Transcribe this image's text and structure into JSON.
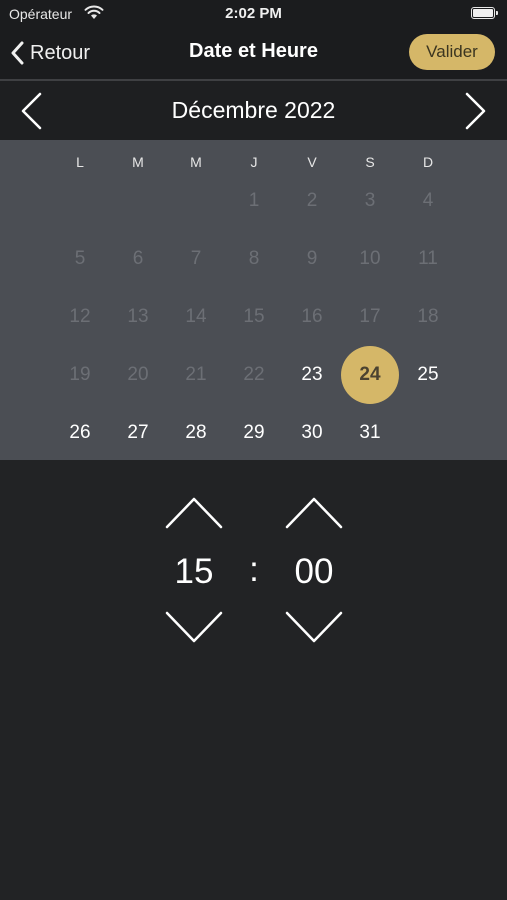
{
  "status_bar": {
    "carrier": "Opérateur",
    "time": "2:02 PM"
  },
  "nav": {
    "back_label": "Retour",
    "title": "Date et Heure",
    "confirm_label": "Valider"
  },
  "calendar": {
    "month_title": "Décembre 2022",
    "weekdays": [
      "L",
      "M",
      "M",
      "J",
      "V",
      "S",
      "D"
    ],
    "rows": [
      [
        null,
        null,
        null,
        "1",
        "2",
        "3",
        "4"
      ],
      [
        "5",
        "6",
        "7",
        "8",
        "9",
        "10",
        "11"
      ],
      [
        "12",
        "13",
        "14",
        "15",
        "16",
        "17",
        "18"
      ],
      [
        "19",
        "20",
        "21",
        "22",
        "23",
        "24",
        "25"
      ],
      [
        "26",
        "27",
        "28",
        "29",
        "30",
        "31",
        null
      ]
    ],
    "first_available_day": 23,
    "selected_day": 24
  },
  "time": {
    "hours": "15",
    "separator": ":",
    "minutes": "00"
  },
  "colors": {
    "accent": "#d5b768",
    "background": "#222325",
    "calendar_bg": "#4b4e54"
  }
}
